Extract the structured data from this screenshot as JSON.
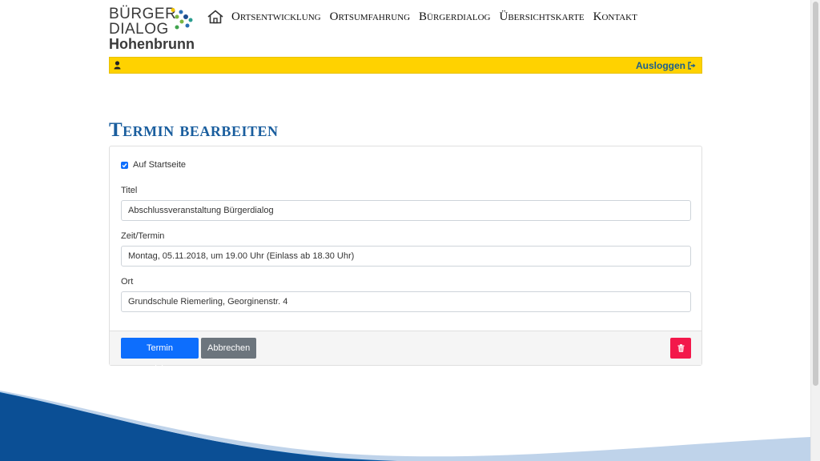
{
  "brand": {
    "line1": "BÜRGER",
    "line2": "DIALOG",
    "line3": "Hohenbrunn"
  },
  "nav": {
    "items": [
      "Ortsentwicklung",
      "Ortsumfahrung",
      "Bürgerdialog",
      "Übersichtskarte",
      "Kontakt"
    ]
  },
  "userbar": {
    "logout_label": "Ausloggen"
  },
  "page": {
    "title": "Termin bearbeiten"
  },
  "form": {
    "startpage_label": "Auf Startseite",
    "startpage_checked": true,
    "title_label": "Titel",
    "title_value": "Abschlussveranstaltung Bürgerdialog",
    "time_label": "Zeit/Termin",
    "time_value": "Montag, 05.11.2018, um 19.00 Uhr (Einlass ab 18.30 Uhr)",
    "place_label": "Ort",
    "place_value": "Grundschule Riemerling, Georginenstr. 4"
  },
  "buttons": {
    "save_label": "Termin speichern",
    "cancel_label": "Abbrechen"
  },
  "colors": {
    "accent_yellow": "#ffd200",
    "title_blue": "#1a5e9e",
    "primary": "#0d6efd",
    "secondary": "#6c757d",
    "danger": "#f3184b"
  }
}
